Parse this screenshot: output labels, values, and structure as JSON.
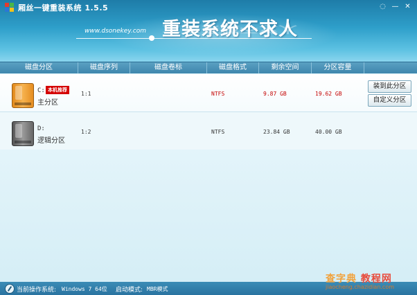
{
  "app": {
    "title": "厢丝一键重装系统 1.5.5",
    "site": "www.dsonekey.com",
    "slogan": "重装系统不求人"
  },
  "window_controls": [
    {
      "icon": "speech-bubble-icon",
      "glyph": "◌"
    },
    {
      "icon": "minimize-icon",
      "glyph": "—"
    },
    {
      "icon": "close-icon",
      "glyph": "✕"
    }
  ],
  "columns": [
    "磁盘分区",
    "磁盘序列",
    "磁盘卷标",
    "磁盘格式",
    "剩余空间",
    "分区容量"
  ],
  "partitions": [
    {
      "drive": "C:",
      "badge": "本机推荐",
      "type": "主分区",
      "sequence": "1:1",
      "label": "",
      "format": "NTFS",
      "free": "9.87 GB",
      "capacity": "19.62 GB",
      "icon": "orange-disk-icon"
    },
    {
      "drive": "D:",
      "type": "逻辑分区",
      "sequence": "1:2",
      "label": "",
      "format": "NTFS",
      "free": "23.84 GB",
      "capacity": "40.00 GB",
      "icon": "gray-disk-icon"
    }
  ],
  "actions": {
    "install": "装到此分区",
    "custom": "自定义分区"
  },
  "status": {
    "os_label": "当前操作系统:",
    "os_value": "Windows 7 64位",
    "boot_label": "启动模式:",
    "boot_value": "MBR模式"
  },
  "watermark": {
    "brand": "查字典",
    "brand2": "教程网",
    "url": "jiaocheng.chazidian.com"
  },
  "colors": {
    "header": "#2e9fca",
    "alert_red": "#c40000",
    "badge_red": "#d40000"
  }
}
